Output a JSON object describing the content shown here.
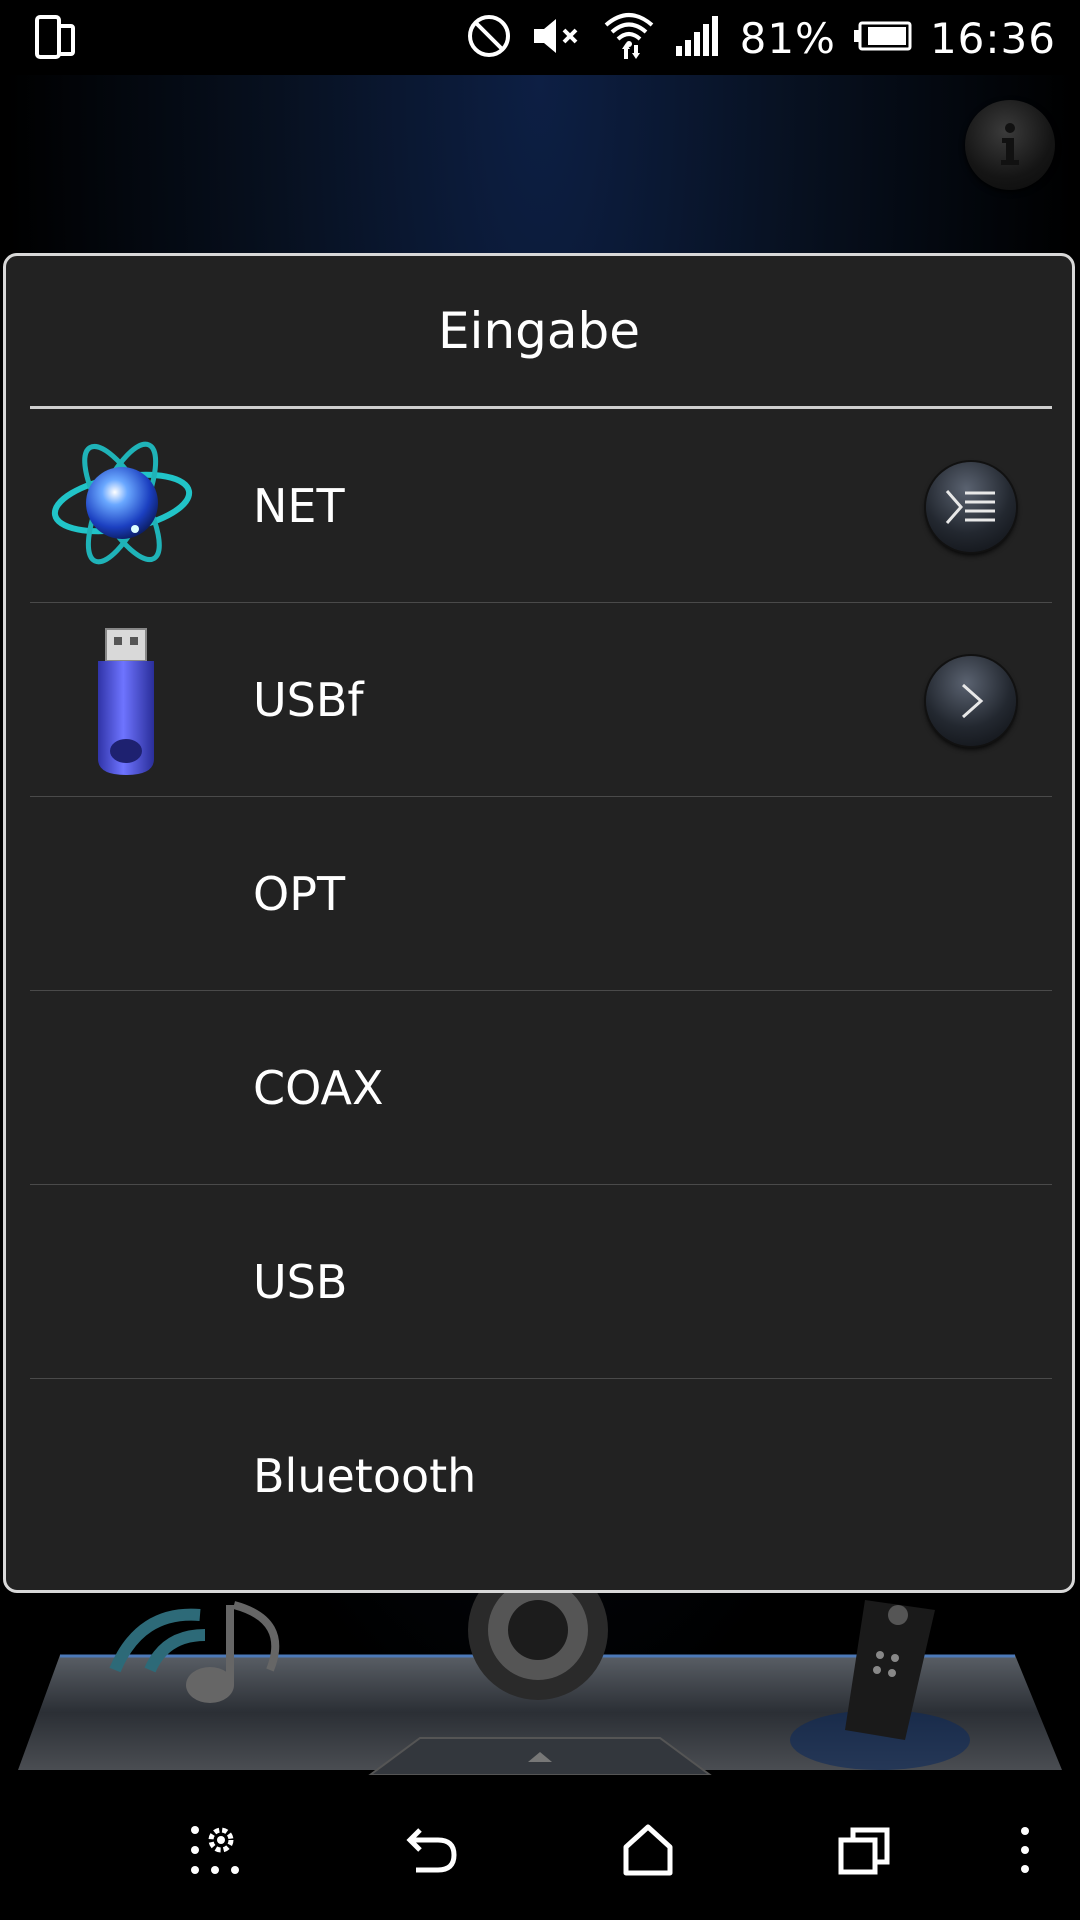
{
  "status_bar": {
    "battery_percent": "81%",
    "time": "16:36",
    "icons": [
      "dual-screen-icon",
      "do-not-disturb-icon",
      "mute-icon",
      "wifi-icon",
      "signal-icon",
      "battery-icon"
    ]
  },
  "dialog": {
    "title": "Eingabe",
    "items": [
      {
        "label": "NET",
        "icon": "network-atom-icon",
        "action": "menu-list-icon"
      },
      {
        "label": "USBf",
        "icon": "usb-stick-icon",
        "action": "chevron-right-icon"
      },
      {
        "label": "OPT"
      },
      {
        "label": "COAX"
      },
      {
        "label": "USB"
      },
      {
        "label": "Bluetooth"
      }
    ]
  },
  "nav_bar": {
    "icons": [
      "app-settings-icon",
      "back-icon",
      "home-icon",
      "recents-icon",
      "overflow-menu-icon"
    ]
  }
}
